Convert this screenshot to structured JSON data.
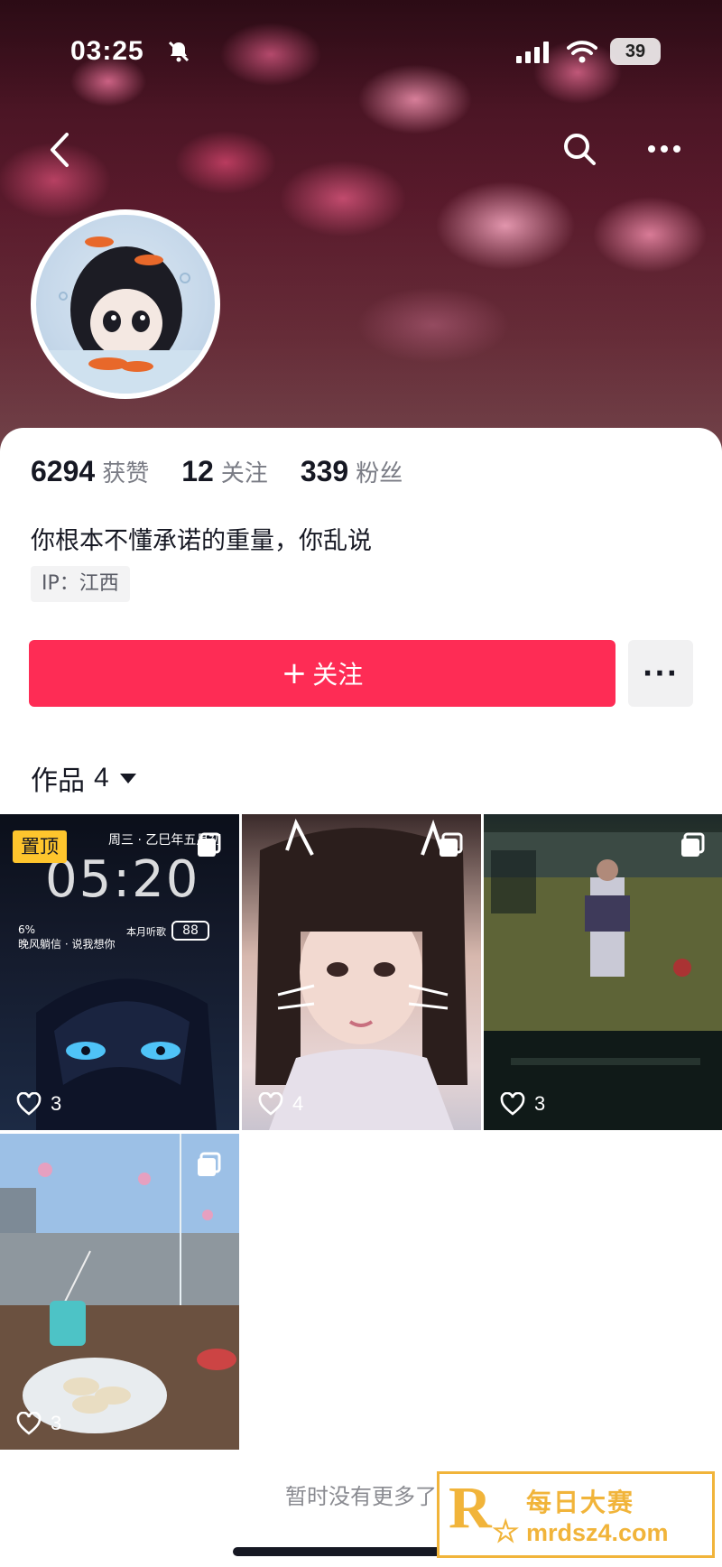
{
  "status_bar": {
    "time": "03:25",
    "battery": "39"
  },
  "profile": {
    "stats": [
      {
        "number": "6294",
        "label": "获赞"
      },
      {
        "number": "12",
        "label": "关注"
      },
      {
        "number": "339",
        "label": "粉丝"
      }
    ],
    "bio": "你根本不懂承诺的重量，你乱说",
    "ip": "IP：江西"
  },
  "actions": {
    "follow_label": "关注",
    "follow_prefix": "+",
    "more_label": "···"
  },
  "works": {
    "tab_label": "作品",
    "count": "4",
    "items": [
      {
        "likes": "3",
        "pinned_label": "置顶",
        "overlay": {
          "date": "周三 · 乙巳年五月初",
          "time": "05:20",
          "widget_a_line1": "6%",
          "widget_a_line2": "晚风躺信 · 说我想你",
          "widget_b": "本月听歌",
          "widget_num": "88"
        }
      },
      {
        "likes": "4"
      },
      {
        "likes": "3"
      },
      {
        "likes": "3"
      }
    ]
  },
  "footer": {
    "end_text": "暂时没有更多了"
  },
  "watermark": {
    "name": "每日大赛",
    "url": "mrdsz4.com",
    "logo_letter": "R",
    "logo_star": "☆"
  },
  "colors": {
    "accent": "#fe2c55",
    "pin": "#fec52d",
    "watermark": "#f1b43a"
  },
  "icons": [
    "back-icon",
    "search-icon",
    "more-icon",
    "bell-muted-icon",
    "signal-icon",
    "wifi-icon",
    "heart-icon",
    "multi-image-icon"
  ]
}
